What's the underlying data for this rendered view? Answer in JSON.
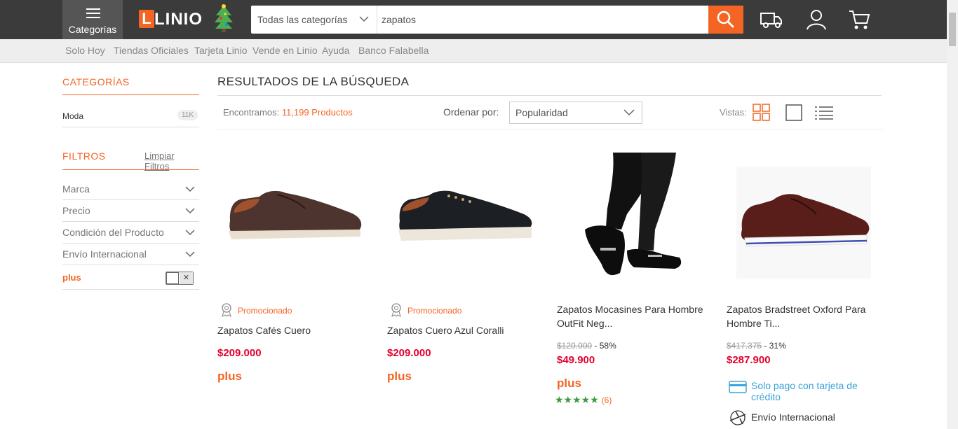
{
  "header": {
    "categories_label": "Categorías",
    "logo_text": "LINIO",
    "logo_letter": "L",
    "search": {
      "category": "Todas las categorías",
      "query": "zapatos"
    },
    "icons": [
      "menu-icon",
      "tree-icon",
      "chevron-down-icon",
      "search-icon",
      "truck-icon",
      "user-icon",
      "cart-icon"
    ],
    "accent": "#f46524",
    "bar_color": "#3b3b3b"
  },
  "subnav": [
    "Solo Hoy",
    "Tiendas Oficiales",
    "Tarjeta Linio",
    "Vende en Linio",
    "Ayuda",
    "Banco Falabella"
  ],
  "sidebar": {
    "categories_title": "CATEGORÍAS",
    "category": {
      "name": "Moda",
      "count": "11K"
    },
    "filters_title": "FILTROS",
    "clear_filters": "Limpiar Filtros",
    "filters": [
      "Marca",
      "Precio",
      "Condición del Producto",
      "Envío Internacional"
    ],
    "plus_label": "plus",
    "plus_toggle_mark": "✕"
  },
  "results": {
    "title": "RESULTADOS DE LA BÚSQUEDA",
    "found_prefix": "Encontramos:",
    "found_count": "11,199 Productos",
    "sort_label": "Ordenar por:",
    "sort_value": "Popularidad",
    "views_label": "Vistas:"
  },
  "products": [
    {
      "promoted": "Promocionado",
      "name": "Zapatos Cafés Cuero",
      "price": "$209.000",
      "plus": "plus"
    },
    {
      "promoted": "Promocionado",
      "name": "Zapatos Cuero Azul Coralli",
      "price": "$209.000",
      "plus": "plus"
    },
    {
      "name_line1": "Zapatos Mocasines Para Hombre",
      "name_line2": "OutFit Neg...",
      "old_price": "$120.000",
      "discount": "- 58%",
      "price": "$49.900",
      "plus": "plus",
      "stars": "★★★★★",
      "rating": 5,
      "reviews": "(6)"
    },
    {
      "name_line1": "Zapatos Bradstreet Oxford Para",
      "name_line2": "Hombre Ti...",
      "old_price": "$417.375",
      "discount": "- 31%",
      "price": "$287.900",
      "card_note_line1": "Solo pago con tarjeta de",
      "card_note_line2": "crédito",
      "shipping": "Envío Internacional"
    }
  ]
}
